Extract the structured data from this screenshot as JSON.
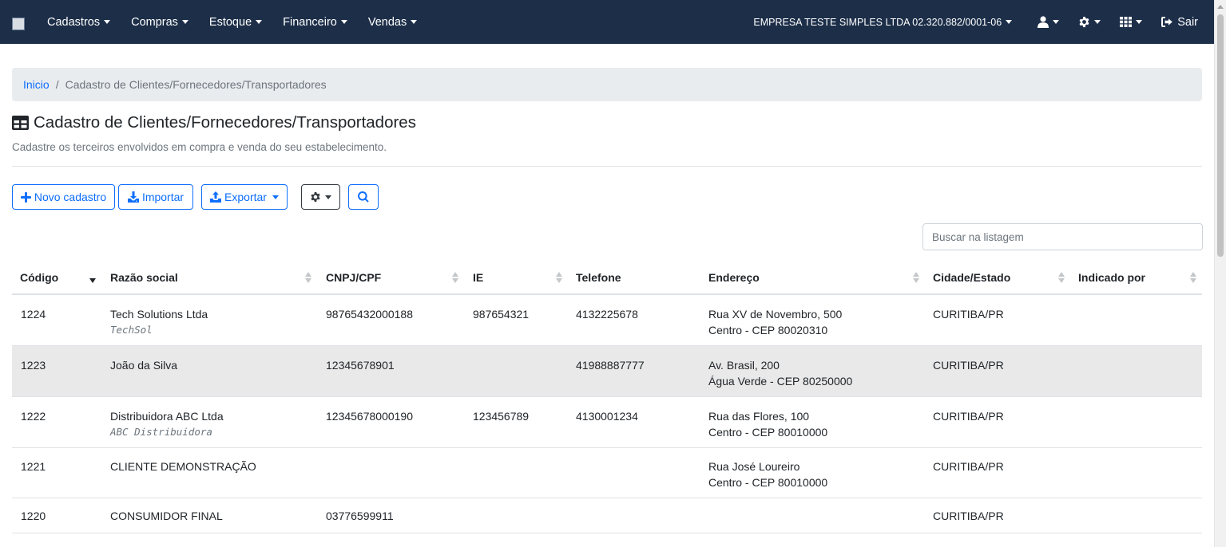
{
  "navbar": {
    "logo_alt": "",
    "menu": [
      {
        "label": "Cadastros"
      },
      {
        "label": "Compras"
      },
      {
        "label": "Estoque"
      },
      {
        "label": "Financeiro"
      },
      {
        "label": "Vendas"
      }
    ],
    "company": "EMPRESA TESTE SIMPLES LTDA 02.320.882/0001-06",
    "logout_label": "Sair",
    "colors": {
      "background": "#1c2e48",
      "text": "#ffffff"
    }
  },
  "breadcrumb": {
    "home": "Inicio",
    "current": "Cadastro de Clientes/Fornecedores/Transportadores"
  },
  "page": {
    "title": "Cadastro de Clientes/Fornecedores/Transportadores",
    "title_icon": "table-icon",
    "subtitle": "Cadastre os terceiros envolvidos em compra e venda do seu estabelecimento."
  },
  "toolbar": {
    "new_label": "Novo cadastro",
    "import_label": "Importar",
    "export_label": "Exportar",
    "settings_icon": "gear-icon",
    "search_icon": "search-icon"
  },
  "search": {
    "placeholder": "Buscar na listagem",
    "value": ""
  },
  "table": {
    "columns": [
      {
        "label": "Código",
        "sort": "desc"
      },
      {
        "label": "Razão social",
        "sort": "none"
      },
      {
        "label": "CNPJ/CPF",
        "sort": "none"
      },
      {
        "label": "IE",
        "sort": "none"
      },
      {
        "label": "Telefone",
        "sort": "none"
      },
      {
        "label": "Endereço",
        "sort": "none"
      },
      {
        "label": "Cidade/Estado",
        "sort": "none"
      },
      {
        "label": "Indicado por",
        "sort": "none"
      }
    ],
    "rows": [
      {
        "code": "1224",
        "name": "Tech Solutions Ltda",
        "nickname": "TechSol",
        "doc": "98765432000188",
        "ie": "987654321",
        "phone": "4132225678",
        "address1": "Rua XV de Novembro, 500",
        "address2": "Centro - CEP 80020310",
        "city": "CURITIBA/PR",
        "indicated": ""
      },
      {
        "code": "1223",
        "name": "João da Silva",
        "nickname": "",
        "doc": "12345678901",
        "ie": "",
        "phone": "41988887777",
        "address1": "Av. Brasil, 200",
        "address2": "Água Verde - CEP 80250000",
        "city": "CURITIBA/PR",
        "indicated": ""
      },
      {
        "code": "1222",
        "name": "Distribuidora ABC Ltda",
        "nickname": "ABC Distribuidora",
        "doc": "12345678000190",
        "ie": "123456789",
        "phone": "4130001234",
        "address1": "Rua das Flores, 100",
        "address2": "Centro - CEP 80010000",
        "city": "CURITIBA/PR",
        "indicated": ""
      },
      {
        "code": "1221",
        "name": "CLIENTE DEMONSTRAÇÃO",
        "nickname": "",
        "doc": "",
        "ie": "",
        "phone": "",
        "address1": "Rua José Loureiro",
        "address2": "Centro - CEP 80010000",
        "city": "CURITIBA/PR",
        "indicated": ""
      },
      {
        "code": "1220",
        "name": "CONSUMIDOR FINAL",
        "nickname": "",
        "doc": "03776599911",
        "ie": "",
        "phone": "",
        "address1": "",
        "address2": "",
        "city": "CURITIBA/PR",
        "indicated": ""
      }
    ],
    "striped_color": "#e9e9e9"
  }
}
